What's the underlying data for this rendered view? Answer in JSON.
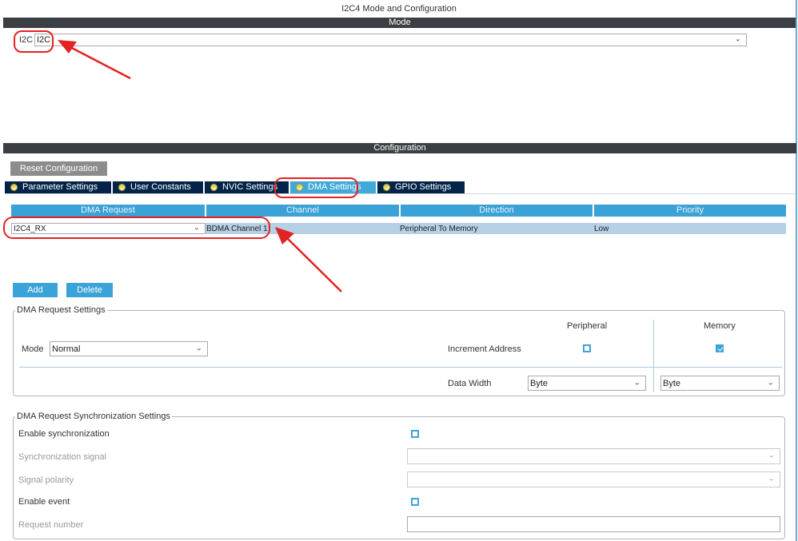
{
  "window": {
    "title": "I2C4 Mode and Configuration"
  },
  "mode": {
    "header": "Mode",
    "i2c_label": "I2C",
    "i2c_value": "I2C"
  },
  "configuration": {
    "header": "Configuration",
    "reset_button": "Reset Configuration",
    "tabs": [
      {
        "label": "Parameter Settings",
        "icon": "check-icon",
        "active": false
      },
      {
        "label": "User Constants",
        "icon": "check-icon",
        "active": false
      },
      {
        "label": "NVIC Settings",
        "icon": "check-icon",
        "active": false
      },
      {
        "label": "DMA Settings",
        "icon": "check-icon",
        "active": true
      },
      {
        "label": "GPIO Settings",
        "icon": "check-icon",
        "active": false
      }
    ]
  },
  "dma_table": {
    "columns": [
      "DMA Request",
      "Channel",
      "Direction",
      "Priority"
    ],
    "rows": [
      {
        "request": "I2C4_RX",
        "channel": "BDMA Channel 1",
        "direction": "Peripheral To Memory",
        "priority": "Low"
      }
    ],
    "add_button": "Add",
    "delete_button": "Delete"
  },
  "dma_request_settings": {
    "legend": "DMA Request Settings",
    "mode_label": "Mode",
    "mode_value": "Normal",
    "peripheral_header": "Peripheral",
    "memory_header": "Memory",
    "increment_address_label": "Increment Address",
    "peripheral_increment": false,
    "memory_increment": true,
    "data_width_label": "Data Width",
    "peripheral_data_width": "Byte",
    "memory_data_width": "Byte"
  },
  "sync_settings": {
    "legend": "DMA Request Synchronization Settings",
    "enable_sync_label": "Enable synchronization",
    "sync_signal_label": "Synchronization signal",
    "signal_polarity_label": "Signal polarity",
    "enable_event_label": "Enable event",
    "request_number_label": "Request number"
  },
  "colors": {
    "header_bar": "#3b3f43",
    "tab_bg": "#032448",
    "tab_active": "#41a9d8",
    "table_header": "#3aa2d6",
    "selected_row": "#b6d0e6",
    "annotation": "#e32222"
  }
}
